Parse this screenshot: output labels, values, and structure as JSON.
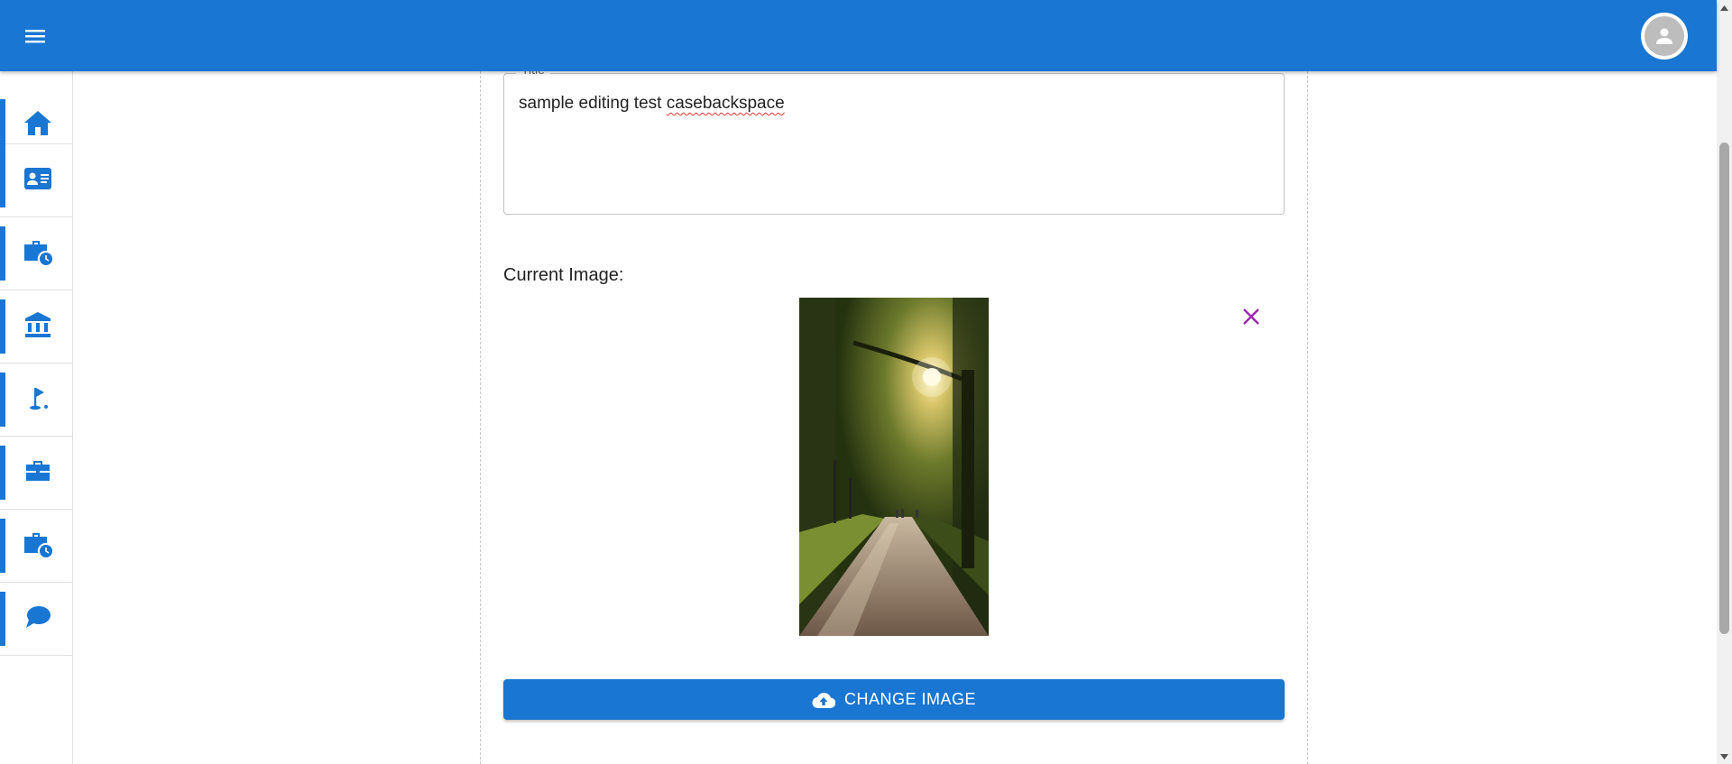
{
  "header": {
    "menu_icon": "hamburger-menu-icon",
    "avatar_icon": "account-circle-icon",
    "color": "#1976d2"
  },
  "sidebar": {
    "items": [
      {
        "icon": "home-icon"
      },
      {
        "icon": "contact-card-icon"
      },
      {
        "icon": "work-history-icon"
      },
      {
        "icon": "bank-icon"
      },
      {
        "icon": "golf-course-icon"
      },
      {
        "icon": "briefcase-icon"
      },
      {
        "icon": "work-history-icon"
      },
      {
        "icon": "chat-bubble-icon"
      }
    ]
  },
  "form": {
    "title_field": {
      "label": "Title",
      "value_plain": "sample editing test ",
      "value_misspelled": "casebackspace"
    },
    "current_image_label": "Current Image:",
    "image": {
      "icon": "park-path-sunlight-photo"
    },
    "remove_icon": "close-icon",
    "remove_color": "#9c27b0",
    "change_image": {
      "label": "CHANGE IMAGE",
      "icon": "cloud-upload-icon"
    }
  }
}
